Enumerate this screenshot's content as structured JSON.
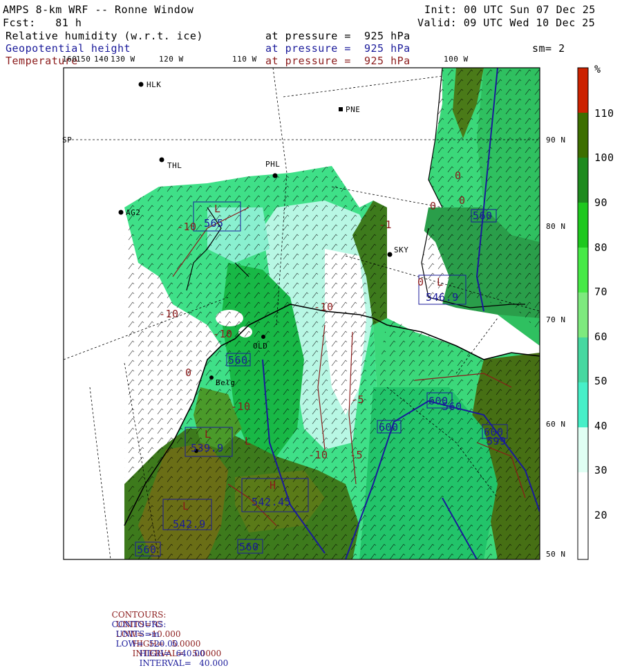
{
  "header": {
    "model": "AMPS 8-km WRF -- Ronne Window",
    "init": "Init: 00 UTC Sun 07 Dec 25",
    "fcst": "Fcst:   81 h",
    "valid": "Valid: 09 UTC Wed 10 Dec 25",
    "fields": [
      {
        "name": "Relative humidity (w.r.t. ice)",
        "level": "at pressure =  925 hPa",
        "color": "#000000"
      },
      {
        "name": "Geopotential height",
        "level": "at pressure =  925 hPa",
        "color": "#1a1a9a"
      },
      {
        "name": "Temperature",
        "level": "at pressure =  925 hPa",
        "color": "#8b1a1a"
      }
    ],
    "smoothing": "sm= 2"
  },
  "map": {
    "lon_labels": [
      "160",
      "150",
      "140",
      "130 W",
      "120 W",
      "110 W",
      "100 W"
    ],
    "lat_labels": [
      "90 N",
      "80 N",
      "70 N",
      "60 N",
      "50 N"
    ],
    "stations": [
      "HLK",
      "PNE",
      "THL",
      "PHL",
      "AG2",
      "SKY",
      "OLD",
      "Belg"
    ],
    "sp_label": "SP",
    "height_labels": [
      "565",
      "560",
      "560",
      "560",
      "600",
      "600",
      "600",
      "542.45",
      "560",
      "546.9",
      "539.9",
      "542.9",
      "599",
      "560"
    ],
    "temp_labels": [
      "-10",
      "-10",
      "-10",
      "-5",
      "-10",
      "-10",
      "-10",
      "-5",
      "-1",
      "0",
      "0",
      "0",
      "0",
      "0"
    ],
    "lh_labels": [
      "L",
      "L",
      "L",
      "L",
      "L",
      "H"
    ]
  },
  "colorbar": {
    "unit": "%",
    "ticks": [
      "110",
      "100",
      "90",
      "80",
      "70",
      "60",
      "50",
      "40",
      "30",
      "20"
    ],
    "colors": [
      "#cc2200",
      "#3d6e00",
      "#1e8a1e",
      "#1ec81e",
      "#46ea46",
      "#7eea7e",
      "#46d8a0",
      "#46f0c8",
      "#e0fff4",
      "#ffffff"
    ]
  },
  "footer": {
    "temp": {
      "label": "CONTOURS:",
      "units": "UNITS=°C",
      "low": "LOW=  -10.000",
      "high": "HIGH=   5.0000",
      "interval": "INTERVAL=   5.0000",
      "color": "#8b1a1a"
    },
    "height": {
      "label": "CONTOURS:",
      "units": "UNITS=m",
      "low": "LOW=  520.00",
      "high": "HIGH=  640.00",
      "interval": "INTERVAL=   40.000",
      "color": "#1a1a9a"
    }
  }
}
